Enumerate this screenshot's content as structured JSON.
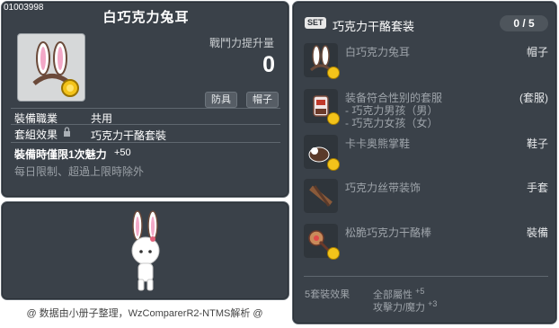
{
  "item": {
    "id": "01003998",
    "title": "白巧克力兔耳",
    "power_label": "戰鬥力提升量",
    "power_value": "0",
    "tags": [
      "防具",
      "帽子"
    ],
    "job_label": "裝備職業",
    "job_value": "共用",
    "set_label": "套組效果",
    "set_value": "巧克力干酪套裝",
    "bonus_label": "裝備時僅限1次魅力",
    "bonus_value": "+50",
    "note": "每日限制、超過上限時除外"
  },
  "footer": "@ 数据由小册子整理，WzComparerR2-NTMS解析 @",
  "set": {
    "badge": "SET",
    "name": "巧克力干酪套装",
    "count": "0 / 5",
    "items": [
      {
        "name": "白巧克力兔耳",
        "type": "帽子"
      },
      {
        "name": "装备符合性别的套服",
        "type": "(套服)",
        "sub": [
          "- 巧克力男孩（男）",
          "- 巧克力女孩（女）"
        ]
      },
      {
        "name": "卡卡奥熊掌鞋",
        "type": "鞋子"
      },
      {
        "name": "巧克力丝带装饰",
        "type": "手套"
      },
      {
        "name": "松脆巧克力干酪棒",
        "type": "裝備"
      }
    ],
    "effect_label": "5套裝效果",
    "effects": [
      {
        "text": "全部屬性",
        "value": "+5"
      },
      {
        "text": "攻擊力/魔力",
        "value": "+3"
      }
    ]
  }
}
